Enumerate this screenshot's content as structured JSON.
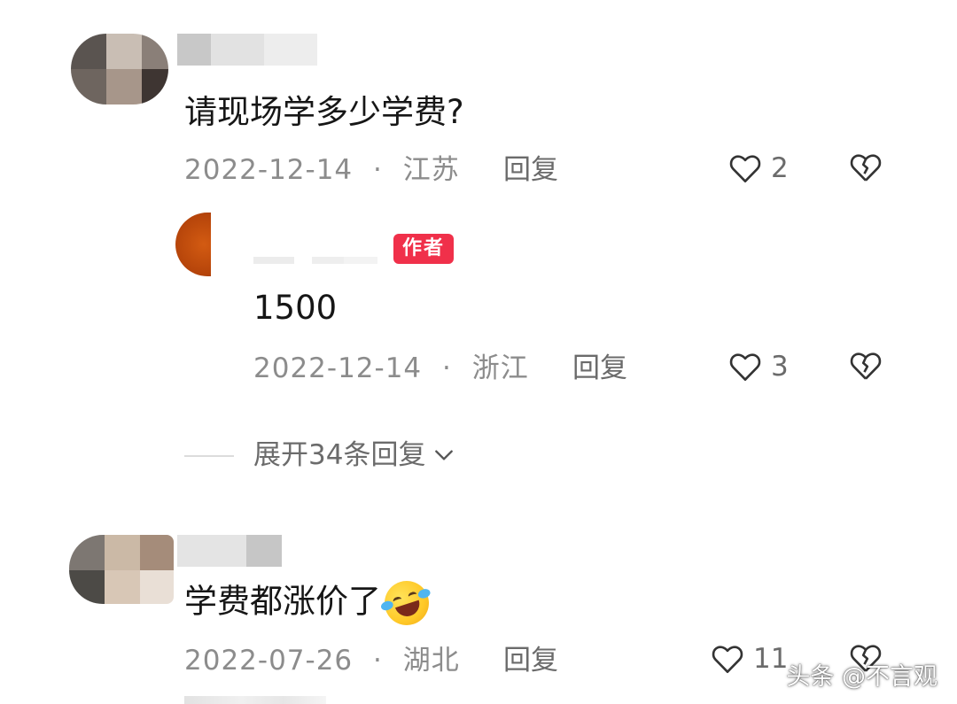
{
  "comments": [
    {
      "text": "请现场学多少学费?",
      "date": "2022-12-14",
      "separator": "·",
      "location": "江苏",
      "reply_label": "回复",
      "likes": "2",
      "replies": [
        {
          "author_badge": "作者",
          "text": "1500",
          "date": "2022-12-14",
          "separator": "·",
          "location": "浙江",
          "reply_label": "回复",
          "likes": "3"
        }
      ],
      "expand_label": "展开34条回复"
    },
    {
      "text": "学费都涨价了",
      "emoji": "rolling-on-floor-laughing",
      "date": "2022-07-26",
      "separator": "·",
      "location": "湖北",
      "reply_label": "回复",
      "likes": "11"
    }
  ],
  "watermark": "头条 @不言观",
  "colors": {
    "text": "#161616",
    "meta": "#8c8c8c",
    "author_badge": "#f0304a"
  },
  "icons": [
    "heart-outline-icon",
    "broken-heart-icon",
    "chevron-down-icon"
  ]
}
